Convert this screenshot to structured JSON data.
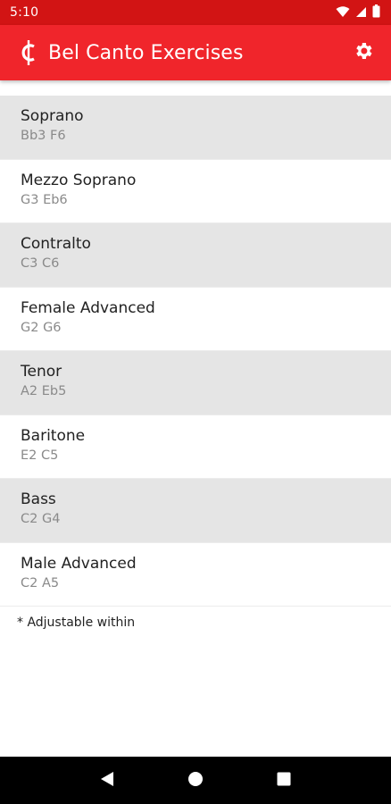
{
  "status_bar": {
    "time": "5:10",
    "icons": [
      "wifi-icon",
      "signal-icon",
      "battery-icon"
    ]
  },
  "app_bar": {
    "title": "Bel Canto Exercises",
    "logo_icon": "cent-sign-icon",
    "settings_icon": "gear-icon",
    "color": "#f0252b"
  },
  "voice_types": [
    {
      "name": "Soprano",
      "range": "Bb3 F6"
    },
    {
      "name": "Mezzo Soprano",
      "range": "G3 Eb6"
    },
    {
      "name": "Contralto",
      "range": "C3 C6"
    },
    {
      "name": "Female Advanced",
      "range": "G2 G6"
    },
    {
      "name": "Tenor",
      "range": "A2 Eb5"
    },
    {
      "name": "Baritone",
      "range": "E2 C5"
    },
    {
      "name": "Bass",
      "range": "C2 G4"
    },
    {
      "name": "Male Advanced",
      "range": "C2 A5"
    }
  ],
  "footnote": "* Adjustable within",
  "nav_bar": {
    "icons": [
      "back-icon",
      "home-icon",
      "recents-icon"
    ]
  }
}
